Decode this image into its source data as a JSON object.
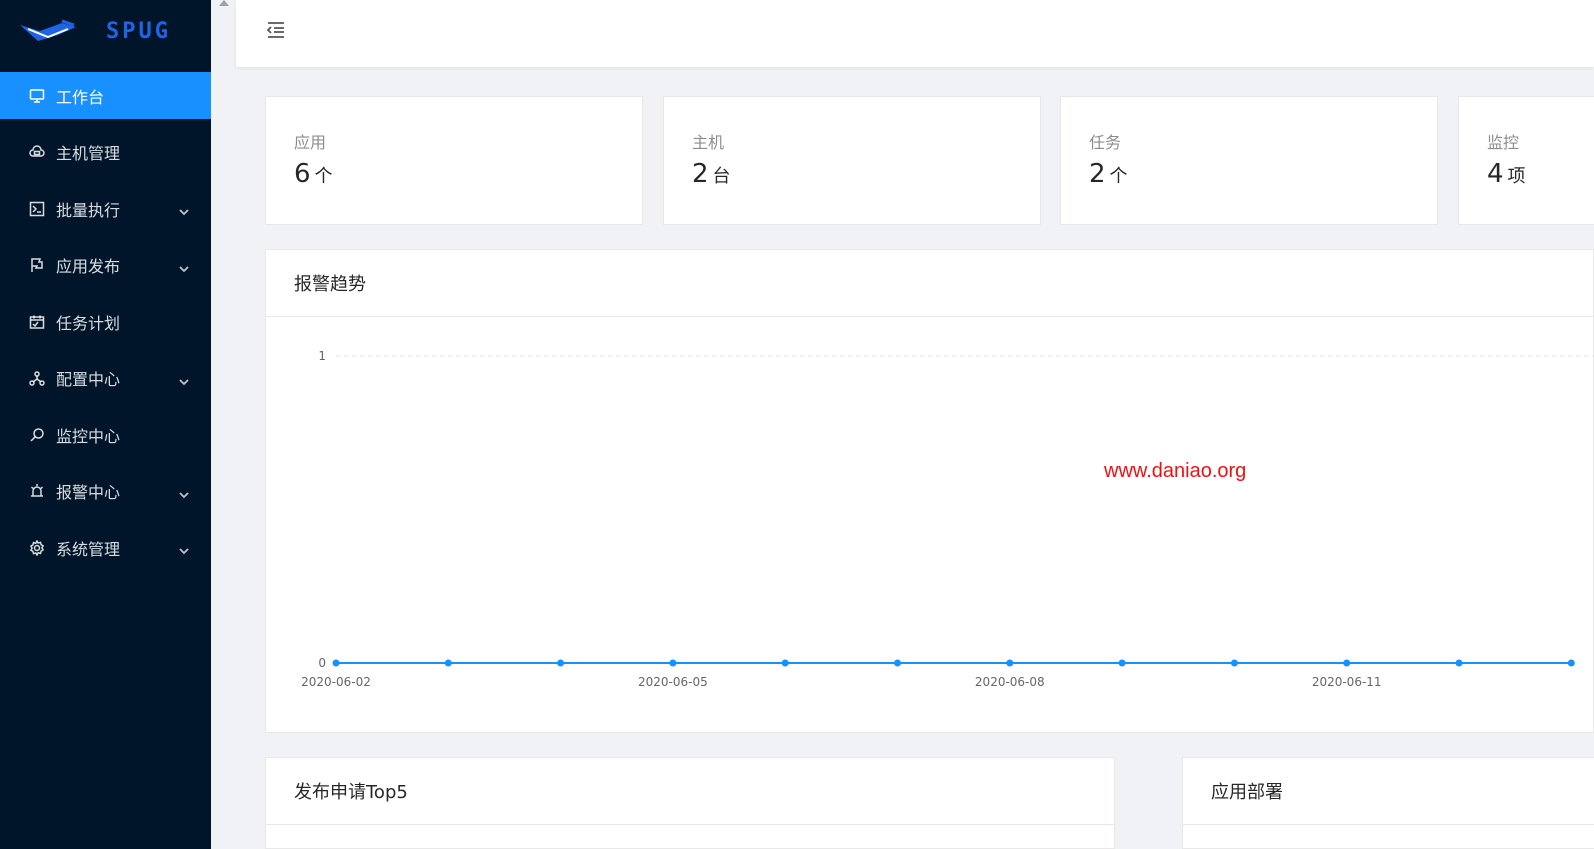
{
  "app": {
    "name": "SPUG"
  },
  "sidebar": {
    "items": [
      {
        "label": "工作台",
        "icon": "desktop-icon",
        "active": true,
        "submenu": false
      },
      {
        "label": "主机管理",
        "icon": "cloud-server-icon",
        "active": false,
        "submenu": false
      },
      {
        "label": "批量执行",
        "icon": "terminal-icon",
        "active": false,
        "submenu": true
      },
      {
        "label": "应用发布",
        "icon": "flag-icon",
        "active": false,
        "submenu": true
      },
      {
        "label": "任务计划",
        "icon": "schedule-icon",
        "active": false,
        "submenu": false
      },
      {
        "label": "配置中心",
        "icon": "deployment-unit-icon",
        "active": false,
        "submenu": true
      },
      {
        "label": "监控中心",
        "icon": "monitor-search-icon",
        "active": false,
        "submenu": false
      },
      {
        "label": "报警中心",
        "icon": "alert-icon",
        "active": false,
        "submenu": true
      },
      {
        "label": "系统管理",
        "icon": "setting-icon",
        "active": false,
        "submenu": true
      }
    ]
  },
  "stats": [
    {
      "title": "应用",
      "value": "6",
      "unit": "个"
    },
    {
      "title": "主机",
      "value": "2",
      "unit": "台"
    },
    {
      "title": "任务",
      "value": "2",
      "unit": "个"
    },
    {
      "title": "监控",
      "value": "4",
      "unit": "项"
    }
  ],
  "alarm_card": {
    "title": "报警趋势"
  },
  "chart_data": {
    "type": "line",
    "x": [
      "2020-06-02",
      "2020-06-03",
      "2020-06-04",
      "2020-06-05",
      "2020-06-06",
      "2020-06-07",
      "2020-06-08",
      "2020-06-09",
      "2020-06-10",
      "2020-06-11",
      "2020-06-12",
      "2020-06-13"
    ],
    "tick_labels": [
      "2020-06-02",
      "2020-06-05",
      "2020-06-08",
      "2020-06-11"
    ],
    "y": [
      0,
      0,
      0,
      0,
      0,
      0,
      0,
      0,
      0,
      0,
      0,
      0
    ],
    "ylim": [
      0,
      1
    ],
    "yticks": [
      "0",
      "1"
    ],
    "grid": true,
    "color": "#1890ff"
  },
  "watermark": "www.daniao.org",
  "bottom_cards": [
    {
      "title": "发布申请Top5"
    },
    {
      "title": "应用部署"
    }
  ],
  "colors": {
    "sidebar_bg": "#001529",
    "accent": "#1890ff",
    "page_bg": "#f0f2f5"
  }
}
